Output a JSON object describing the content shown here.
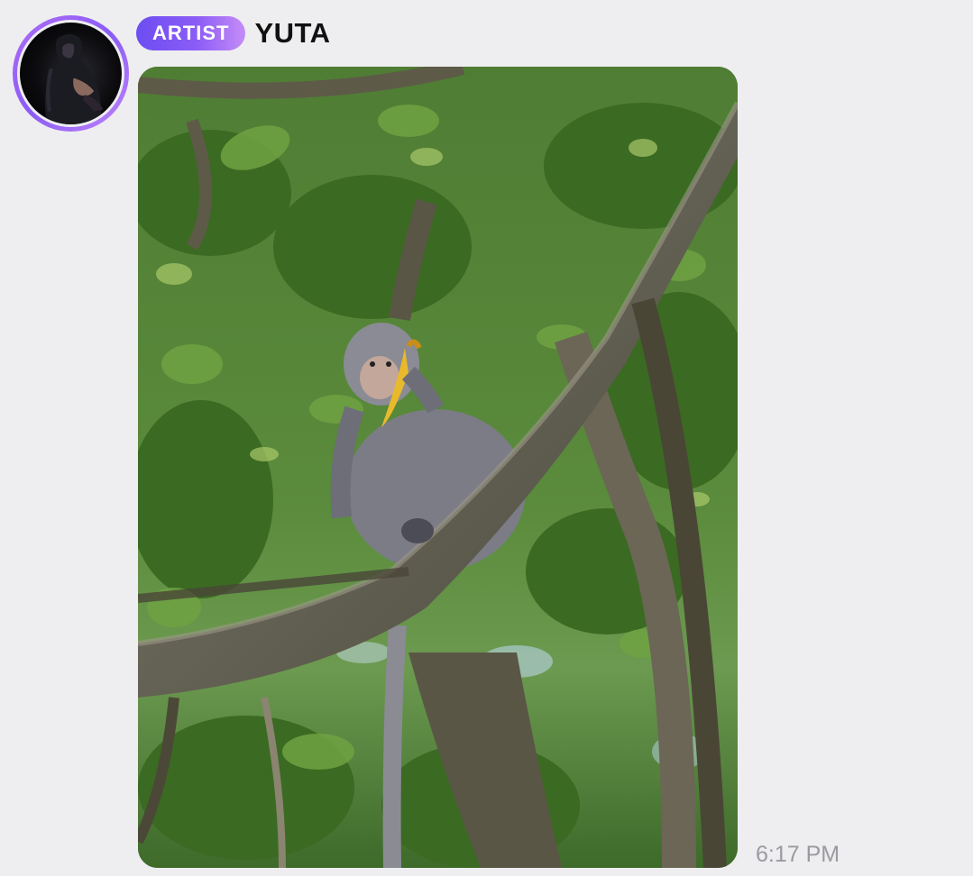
{
  "message": {
    "sender_badge": "ARTIST",
    "sender_name": "YUTA",
    "timestamp": "6:17 PM",
    "attachment_type": "photo"
  },
  "colors": {
    "background": "#eeeef0",
    "badge_gradient_start": "#6d4df2",
    "badge_gradient_end": "#c58cf7",
    "avatar_ring": "#9b6cf6",
    "timestamp": "#9a9aa0"
  },
  "icons": {
    "avatar": "profile-avatar",
    "photo": "monkey-in-tree-photo"
  }
}
